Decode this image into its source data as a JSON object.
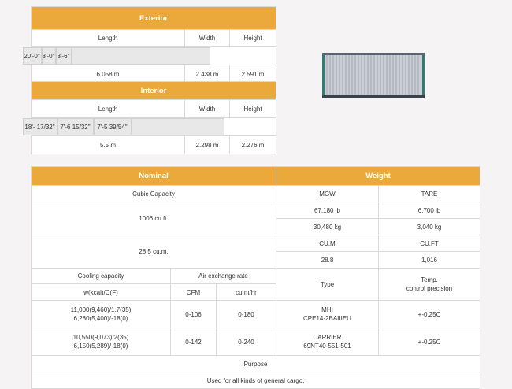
{
  "exterior": {
    "title": "Exterior",
    "headers": [
      "Length",
      "Width",
      "Height"
    ],
    "imperial": [
      "20'-0\"",
      "8'-0\"",
      "8'-6\""
    ],
    "metric": [
      "6.058 m",
      "2.438 m",
      "2.591 m"
    ]
  },
  "interior": {
    "title": "Interior",
    "headers": [
      "Length",
      "Width",
      "Height"
    ],
    "imperial": [
      "18'- 17/32\"",
      "7'-6 15/32\"",
      "7'-5 39/54\""
    ],
    "metric": [
      "5.5 m",
      "2.298 m",
      "2.276 m"
    ]
  },
  "nominal": {
    "title": "Nominal",
    "cubic_capacity_label": "Cubic Capacity",
    "cubic_feet": "1006 cu.ft.",
    "cubic_meters": "28.5 cu.m.",
    "cooling_label": "Cooling capacity",
    "air_label": "Air exchange rate",
    "cooling_units": "w(kcal)/C(F)",
    "cfm_label": "CFM",
    "cum_label": "cu.m/hr",
    "rows": [
      {
        "cool1": "11,000(9,460)/1.7(35)",
        "cool2": "6,280(5,400)/-18(0)",
        "cfm": "0-106",
        "cum": "0-180"
      },
      {
        "cool1": "10,550(9,073)/2(35)",
        "cool2": "6,150(5,289)/-18(0)",
        "cfm": "0-142",
        "cum": "0-240"
      }
    ]
  },
  "weight": {
    "title": "Weight",
    "mgw_label": "MGW",
    "tare_label": "TARE",
    "mgw_lb": "67,180 lb",
    "tare_lb": "6,700 lb",
    "mgw_kg": "30,480 kg",
    "tare_kg": "3,040 kg",
    "cum_label": "CU.M",
    "cuft_label": "CU.FT",
    "cum_value": "28.8",
    "cuft_value": "1,016",
    "type_label": "Type",
    "temp_label_1": "Temp.",
    "temp_label_2": "control precision",
    "rows": [
      {
        "type1": "MHI",
        "type2": "CPE14-2BAIIIEU",
        "temp": "+-0.25C"
      },
      {
        "type1": "CARRIER",
        "type2": "69NT40-551-501",
        "temp": "+-0.25C"
      }
    ]
  },
  "purpose": {
    "label": "Purpose",
    "text": "Used for all kinds of general cargo."
  },
  "colors": {
    "header": "#eba93b",
    "container_frame": "#2e7d73",
    "container_body": "#c9cdd4"
  }
}
